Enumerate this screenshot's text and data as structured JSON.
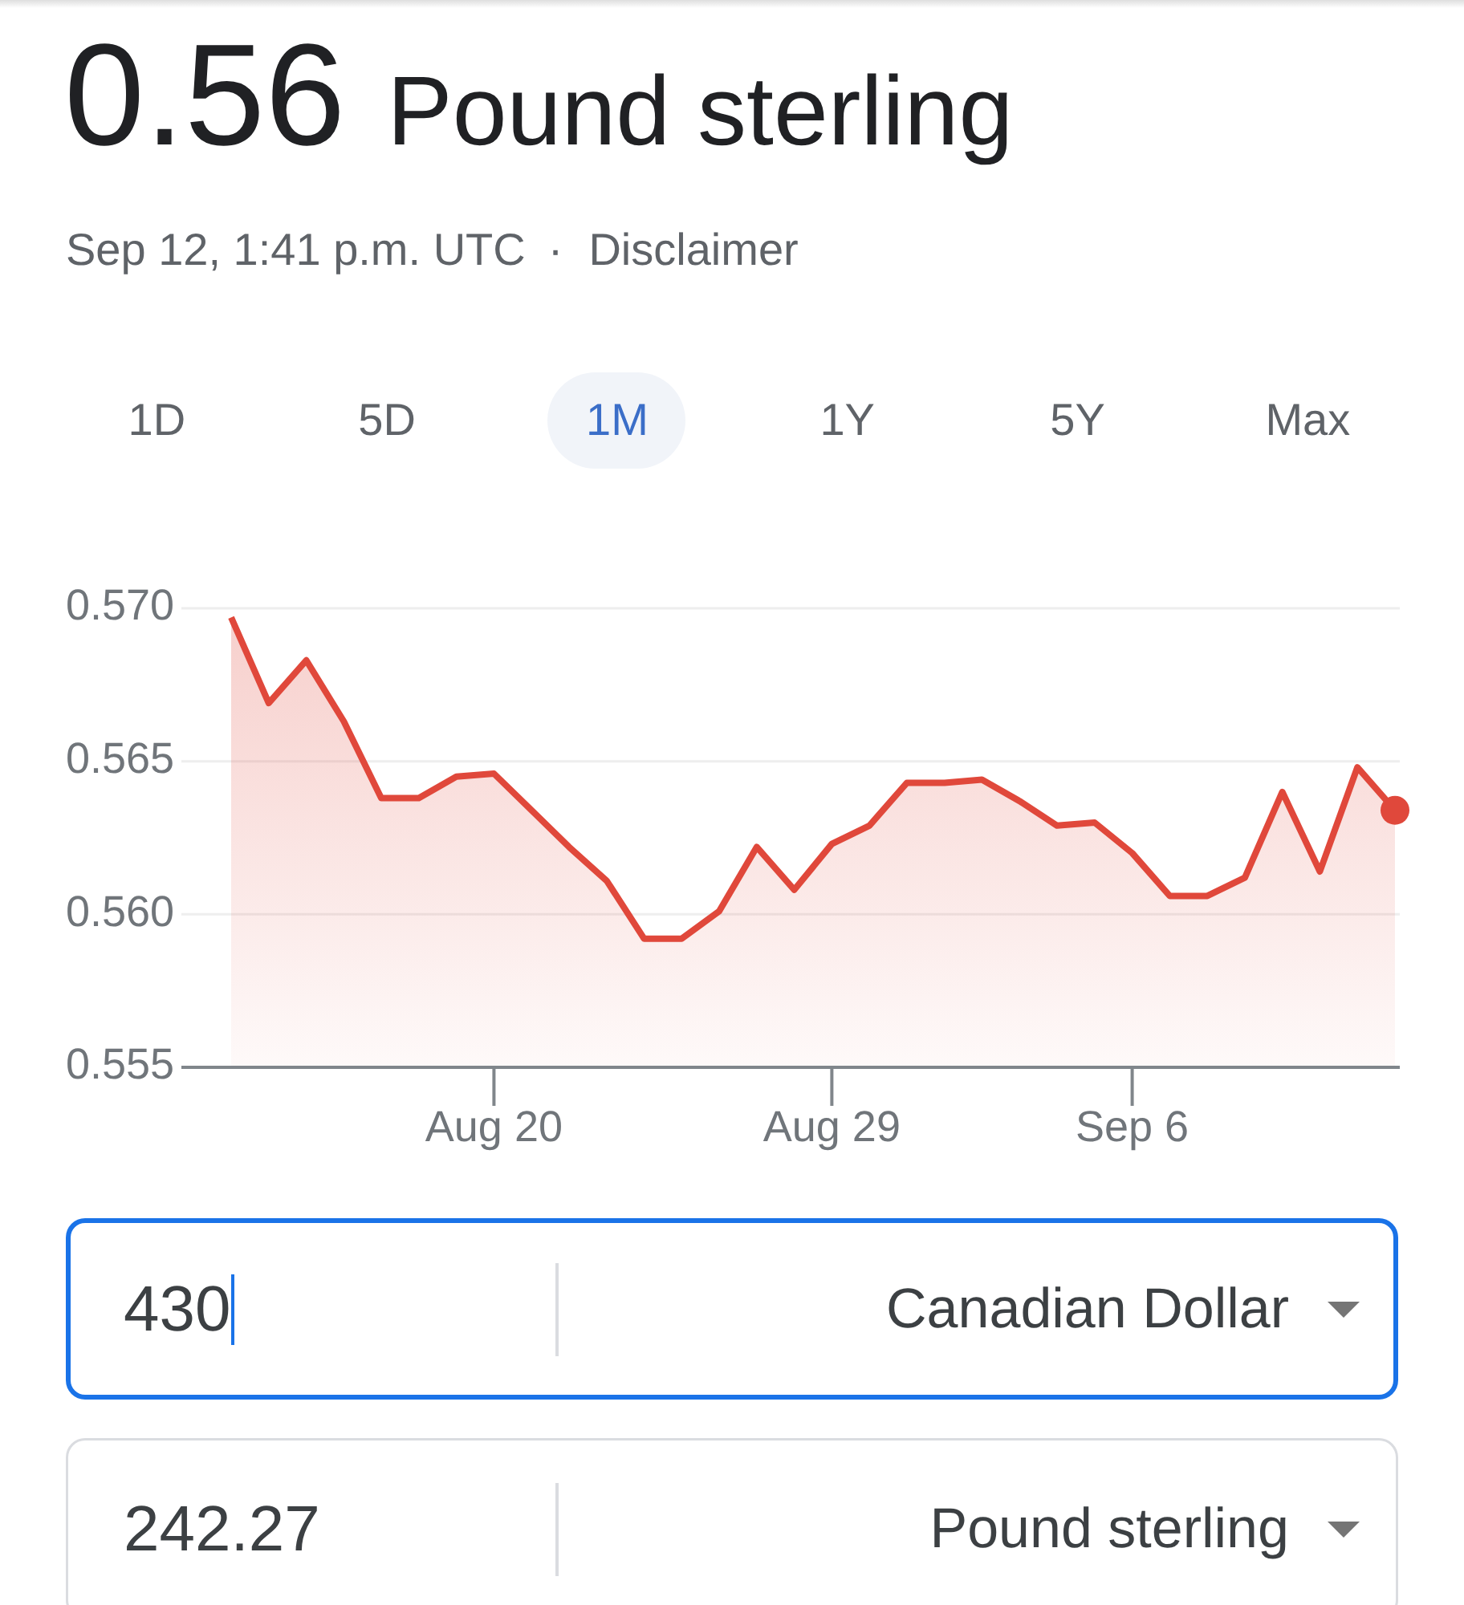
{
  "header": {
    "value": "0.56",
    "currency": "Pound sterling",
    "timestamp": "Sep 12, 1:41 p.m. UTC",
    "separator": "·",
    "disclaimer_link": "Disclaimer"
  },
  "range_tabs": [
    {
      "label": "1D",
      "selected": false
    },
    {
      "label": "5D",
      "selected": false
    },
    {
      "label": "1M",
      "selected": true
    },
    {
      "label": "1Y",
      "selected": false
    },
    {
      "label": "5Y",
      "selected": false
    },
    {
      "label": "Max",
      "selected": false
    }
  ],
  "chart": {
    "chart_data": {
      "type": "area",
      "categories": [
        null,
        null,
        null,
        null,
        null,
        null,
        null,
        "Aug 20",
        null,
        null,
        null,
        null,
        null,
        null,
        null,
        null,
        "Aug 29",
        null,
        null,
        null,
        null,
        null,
        null,
        null,
        "Sep 6",
        null,
        null,
        null,
        null,
        null,
        null,
        null
      ],
      "values": [
        0.5697,
        0.5669,
        0.5683,
        0.5663,
        0.5638,
        0.5638,
        0.5645,
        0.5646,
        0.5634,
        0.5622,
        0.5611,
        0.5592,
        0.5592,
        0.5601,
        0.5622,
        0.5608,
        0.5623,
        0.5629,
        0.5643,
        0.5643,
        0.5644,
        0.5637,
        0.5629,
        0.563,
        0.562,
        0.5606,
        0.5606,
        0.5612,
        0.564,
        0.5614,
        0.5648,
        0.5634
      ],
      "ylim": [
        0.555,
        0.57
      ],
      "yticks": [
        {
          "value": 0.555,
          "label": "0.555"
        },
        {
          "value": 0.56,
          "label": "0.560"
        },
        {
          "value": 0.565,
          "label": "0.565"
        },
        {
          "value": 0.57,
          "label": "0.570"
        }
      ]
    }
  },
  "converter": [
    {
      "amount": "430",
      "currency": "Canadian Dollar",
      "focused": true
    },
    {
      "amount": "242.27",
      "currency": "Pound sterling",
      "focused": false
    }
  ]
}
